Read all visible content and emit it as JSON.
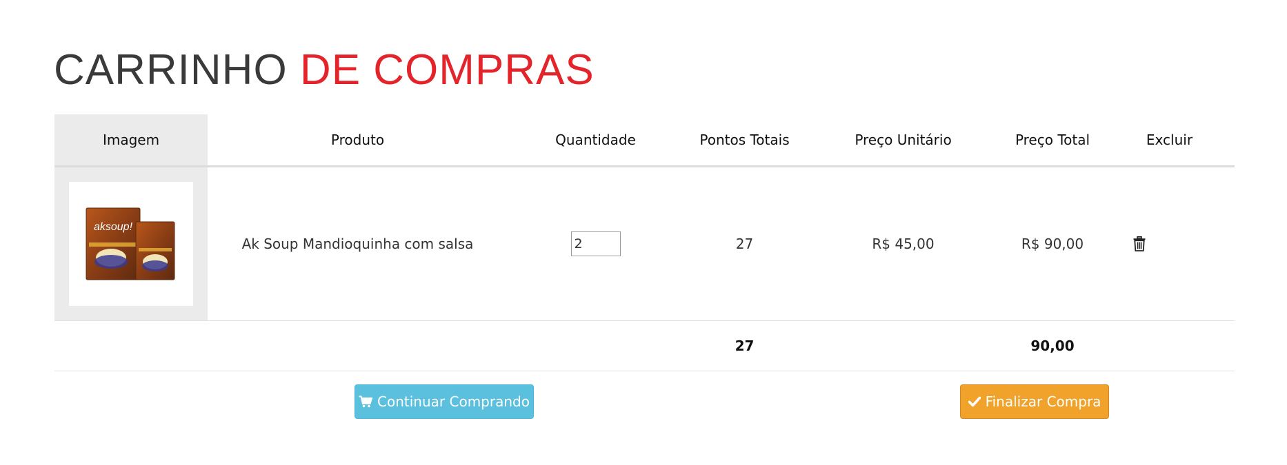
{
  "title": {
    "part1": "CARRINHO",
    "part2": "DE COMPRAS"
  },
  "table": {
    "headers": {
      "image": "Imagem",
      "product": "Produto",
      "quantity": "Quantidade",
      "points": "Pontos Totais",
      "unit_price": "Preço Unitário",
      "total_price": "Preço Total",
      "delete": "Excluir"
    },
    "items": [
      {
        "product": "Ak Soup Mandioquinha com salsa",
        "quantity": "2",
        "points": "27",
        "unit_price": "R$ 45,00",
        "total_price": "R$ 90,00",
        "image_text": "aksoup!"
      }
    ],
    "totals": {
      "points": "27",
      "price": "90,00"
    }
  },
  "buttons": {
    "continue": "Continuar Comprando",
    "finish": "Finalizar Compra"
  },
  "icons": {
    "delete": "trash-icon",
    "continue": "cart-icon",
    "finish": "check-icon"
  },
  "colors": {
    "title_dark": "#3a3a3a",
    "title_accent": "#e3242b",
    "continue_button": "#5bc0de",
    "finish_button": "#f0a22a"
  }
}
